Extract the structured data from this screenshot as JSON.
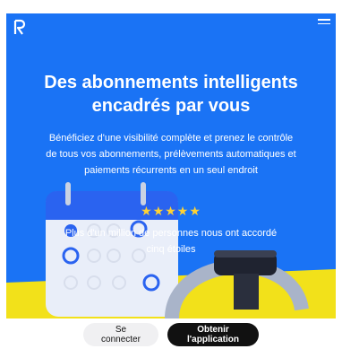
{
  "header": {
    "logo_icon": "revolut-r-logo",
    "menu_icon": "hamburger-menu-icon"
  },
  "hero": {
    "title": "Des abonnements intelligents encadrés par vous",
    "description": "Bénéficiez d'une visibilité complète et prenez le contrôle de tous vos abonnements, prélèvements automatiques et paiements récurrents en un seul endroit",
    "stars": "★★★★★",
    "rating_text": "Plus d'un million de personnes nous ont accordé cinq étoiles",
    "accent_color": "#1a73f5"
  },
  "footer": {
    "login_label": "Se connecter",
    "app_label": "Obtenir l'application"
  }
}
